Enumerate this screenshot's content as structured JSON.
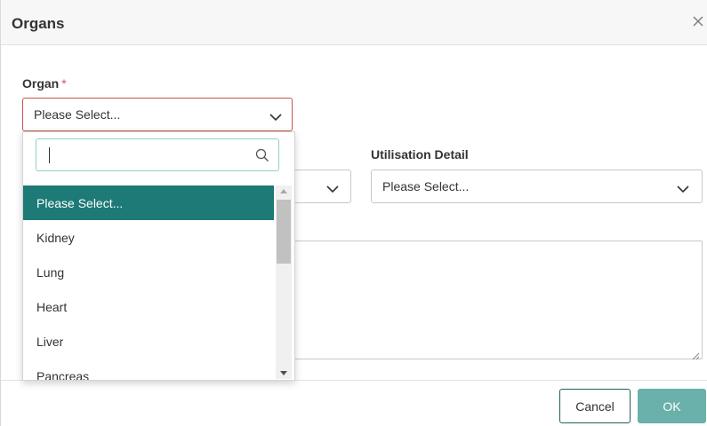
{
  "dialog": {
    "title": "Organs",
    "close_icon": "close-icon"
  },
  "form": {
    "organ": {
      "label": "Organ",
      "required_marker": "*",
      "value": "Please Select..."
    },
    "utilisation_detail": {
      "label": "Utilisation Detail",
      "value": "Please Select..."
    },
    "hidden_select": {
      "value": ""
    }
  },
  "dropdown": {
    "search_value": "",
    "options": [
      {
        "label": "Please Select...",
        "selected": true
      },
      {
        "label": "Kidney",
        "selected": false
      },
      {
        "label": "Lung",
        "selected": false
      },
      {
        "label": "Heart",
        "selected": false
      },
      {
        "label": "Liver",
        "selected": false
      },
      {
        "label": "Pancreas",
        "selected": false
      }
    ]
  },
  "footer": {
    "cancel_label": "Cancel",
    "ok_label": "OK"
  },
  "colors": {
    "accent": "#1d7a76",
    "ok_button": "#69b1aa",
    "required": "#d9534f",
    "error_border": "#c9534a"
  }
}
